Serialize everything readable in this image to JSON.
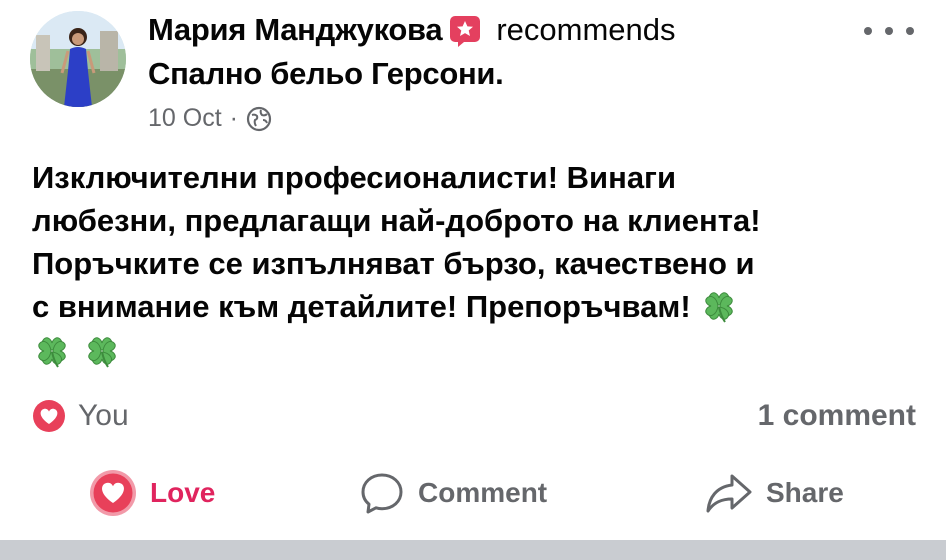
{
  "post": {
    "author": "Мария Манджукова",
    "action": "recommends",
    "page": "Спално бельо Герсони.",
    "date": "10 Oct",
    "separator": "·",
    "text_lines": [
      "Изключителни професионалисти! Винаги",
      "любезни, предлагащи най-доброто на клиента!",
      "Поръчките се изпълняват бързо, качествено и",
      "с внимание към детайлите! Препоръчвам!"
    ]
  },
  "reactions": {
    "reactors": "You",
    "comment_count": "1 comment"
  },
  "actions": {
    "love": "Love",
    "comment": "Comment",
    "share": "Share"
  },
  "icons": {
    "recommend": "recommend-star-icon",
    "privacy": "globe-icon",
    "emoji": "four-leaf-clover-icon",
    "reaction": "love-reaction-icon",
    "more": "more-options-icon",
    "comment": "comment-bubble-icon",
    "share": "share-arrow-icon"
  },
  "colors": {
    "recommend": "#e4405f",
    "love": "#e0245e",
    "secondary_text": "#65676b",
    "clover": "#4caf50"
  }
}
